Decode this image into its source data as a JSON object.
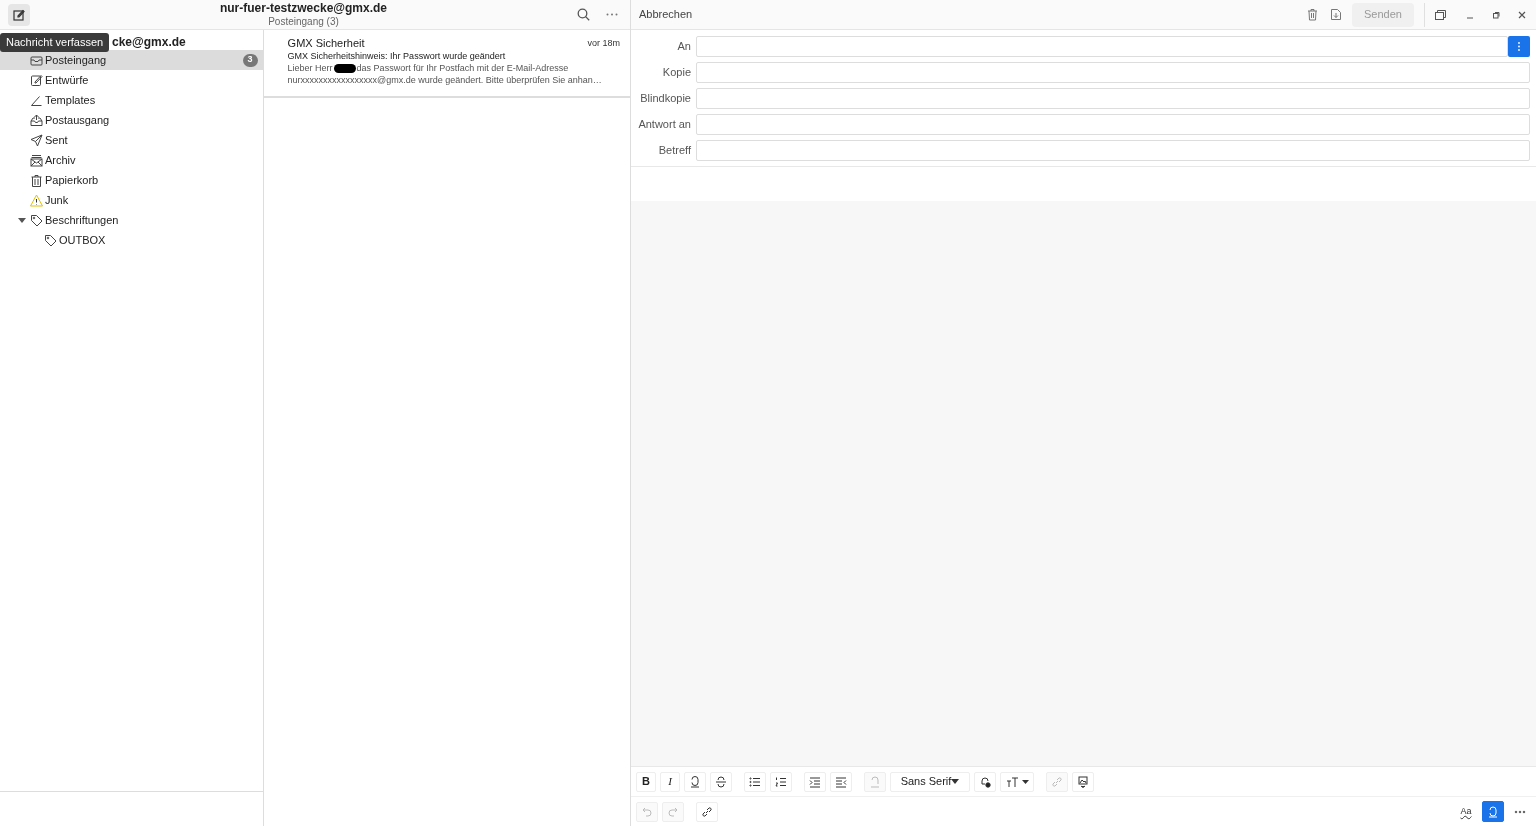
{
  "header": {
    "title": "nur-fuer-testzwecke@gmx.de",
    "subtitle": "Posteingang (3)"
  },
  "tooltip": "Nachricht verfassen",
  "sidebar": {
    "account": "cke@gmx.de",
    "folders": [
      {
        "label": "Posteingang",
        "kind": "inbox",
        "selected": true,
        "count": "3"
      },
      {
        "label": "Entwürfe",
        "kind": "drafts",
        "selected": false
      },
      {
        "label": "Templates",
        "kind": "templates",
        "selected": false
      },
      {
        "label": "Postausgang",
        "kind": "outbox",
        "selected": false
      },
      {
        "label": "Sent",
        "kind": "sent",
        "selected": false
      },
      {
        "label": "Archiv",
        "kind": "archive",
        "selected": false
      },
      {
        "label": "Papierkorb",
        "kind": "trash",
        "selected": false
      },
      {
        "label": "Junk",
        "kind": "junk",
        "selected": false
      },
      {
        "label": "Beschriftungen",
        "kind": "tag",
        "selected": false,
        "expanded": true,
        "children": [
          {
            "label": "OUTBOX",
            "kind": "tag",
            "selected": false
          }
        ]
      }
    ]
  },
  "messages": [
    {
      "sender": "GMX Sicherheit",
      "time": "vor 18m",
      "subject": "GMX Sicherheitshinweis: Ihr Passwort wurde geändert",
      "preview_start": "Lieber Herr",
      "redacted": true,
      "preview_rest": "das Passwort für Ihr Postfach mit der E-Mail-Adresse",
      "preview_line2": "nurxxxxxxxxxxxxxxxxx@gmx.de wurde geändert. Bitte überprüfen Sie anhan…"
    }
  ],
  "compose": {
    "cancel": "Abbrechen",
    "send": {
      "label": "Senden",
      "disabled": true
    },
    "fields": [
      {
        "label": "An",
        "kind": "recipients"
      },
      {
        "label": "Kopie",
        "kind": "text"
      },
      {
        "label": "Blindkopie",
        "kind": "text"
      },
      {
        "label": "Antwort an",
        "kind": "text"
      },
      {
        "label": "Betreff",
        "kind": "text"
      }
    ],
    "format_toolbar": [
      {
        "kind": "bold",
        "label": "B",
        "disabled": false
      },
      {
        "kind": "italic",
        "label": "I",
        "disabled": false
      },
      {
        "kind": "underline",
        "disabled": false
      },
      {
        "kind": "strike",
        "disabled": false
      },
      {
        "kind": "sep"
      },
      {
        "kind": "bullets",
        "disabled": false
      },
      {
        "kind": "numbers",
        "disabled": false
      },
      {
        "kind": "sep"
      },
      {
        "kind": "indent",
        "disabled": false
      },
      {
        "kind": "outdent",
        "disabled": false
      },
      {
        "kind": "sep"
      },
      {
        "kind": "clear",
        "disabled": true
      },
      {
        "kind": "font",
        "label": "Sans Serif",
        "disabled": false
      },
      {
        "kind": "color",
        "disabled": false
      },
      {
        "kind": "size",
        "disabled": false
      },
      {
        "kind": "sep"
      },
      {
        "kind": "link",
        "disabled": true
      },
      {
        "kind": "image",
        "disabled": false
      }
    ],
    "bottom_toolbar": [
      {
        "kind": "undo",
        "disabled": true
      },
      {
        "kind": "redo",
        "disabled": true
      },
      {
        "kind": "sep"
      },
      {
        "kind": "attach",
        "disabled": false
      }
    ],
    "right_tools": [
      {
        "kind": "spell",
        "label": "Aa"
      },
      {
        "kind": "html",
        "on": true
      },
      {
        "kind": "more"
      }
    ]
  }
}
